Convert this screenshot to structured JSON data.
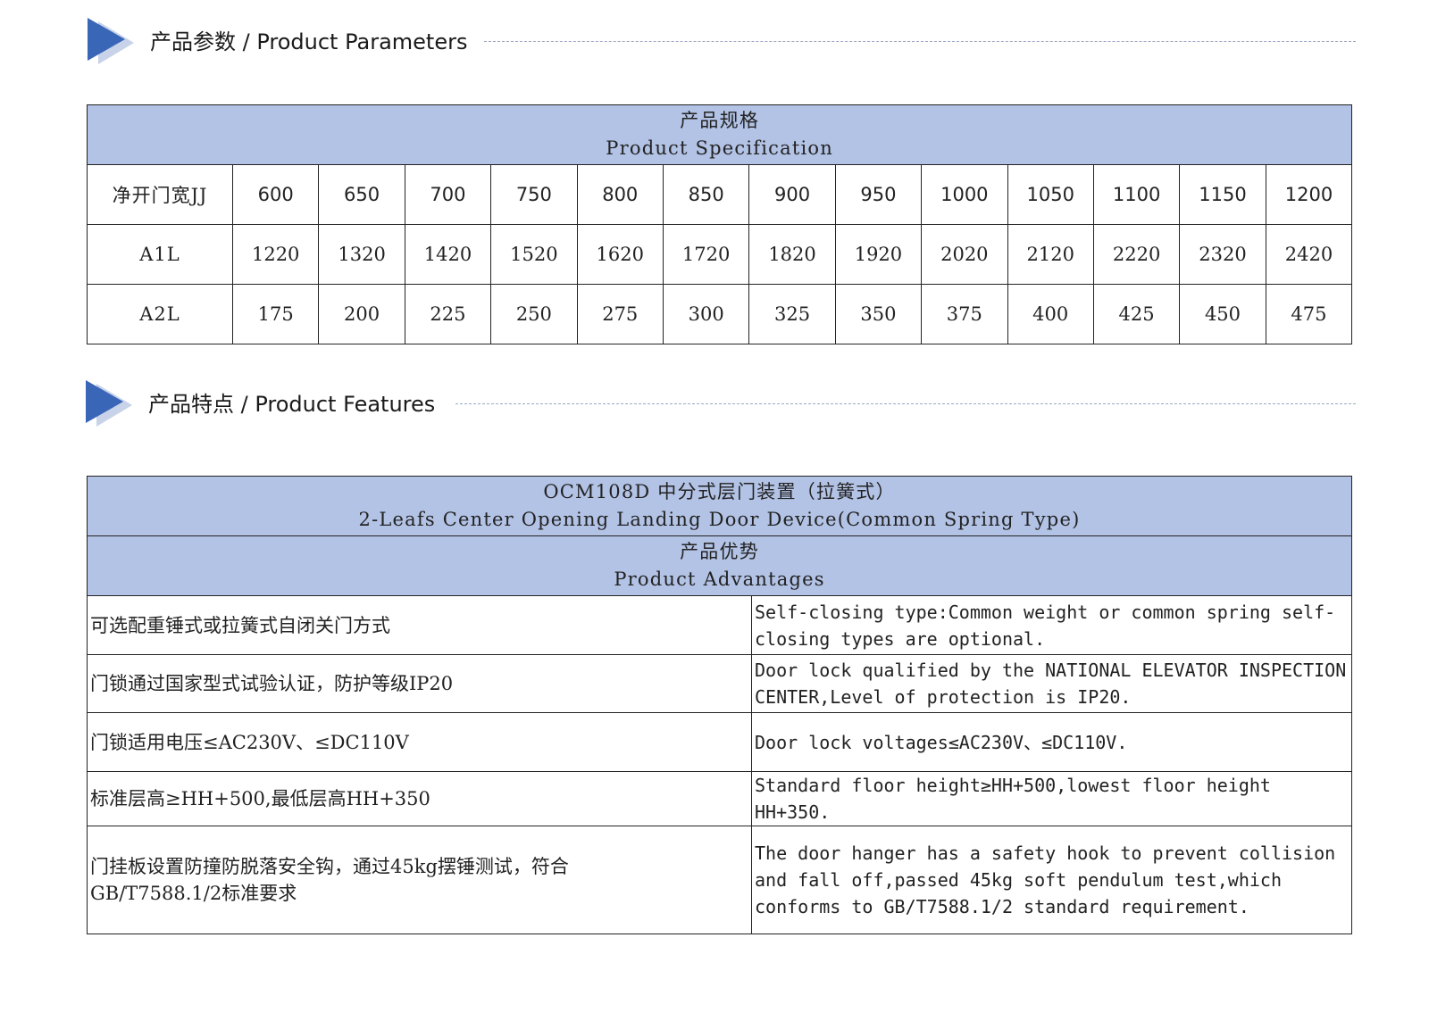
{
  "section1": {
    "title": "产品参数 / Product Parameters"
  },
  "spec_table": {
    "header_cn": "产品规格",
    "header_en": "Product Specification",
    "rows": [
      {
        "label": "净开门宽JJ",
        "values": [
          "600",
          "650",
          "700",
          "750",
          "800",
          "850",
          "900",
          "950",
          "1000",
          "1050",
          "1100",
          "1150",
          "1200"
        ]
      },
      {
        "label": "A1L",
        "values": [
          "1220",
          "1320",
          "1420",
          "1520",
          "1620",
          "1720",
          "1820",
          "1920",
          "2020",
          "2120",
          "2220",
          "2320",
          "2420"
        ]
      },
      {
        "label": "A2L",
        "values": [
          "175",
          "200",
          "225",
          "250",
          "275",
          "300",
          "325",
          "350",
          "375",
          "400",
          "425",
          "450",
          "475"
        ]
      }
    ]
  },
  "section2": {
    "title": "产品特点 / Product Features"
  },
  "feature_table": {
    "model_cn": "OCM108D 中分式层门装置（拉簧式）",
    "model_en": "2-Leafs Center Opening Landing Door Device(Common Spring Type)",
    "adv_cn": "产品优势",
    "adv_en": "Product Advantages",
    "rows": [
      {
        "cn": "可选配重锤式或拉簧式自闭关门方式",
        "en": "Self-closing type:Common weight or common spring self-closing types are optional."
      },
      {
        "cn": "门锁通过国家型式试验认证，防护等级IP20",
        "en": "Door lock qualified by the NATIONAL ELEVATOR INSPECTION CENTER,Level of protection is IP20."
      },
      {
        "cn": "门锁适用电压≤AC230V、≤DC110V",
        "en": "Door lock voltages≤AC230V、≤DC110V."
      },
      {
        "cn": "标准层高≥HH+500,最低层高HH+350",
        "en": "Standard floor height≥HH+500,lowest floor height HH+350."
      },
      {
        "cn": "门挂板设置防撞防脱落安全钩，通过45kg摆锤测试，符合GB/T7588.1/2标准要求",
        "en": "The door hanger has a safety hook to prevent collision and fall off,passed 45kg soft pendulum test,which conforms to GB/T7588.1/2 standard requirement."
      }
    ]
  },
  "colors": {
    "accent": "#3a66b8",
    "header_fill": "#b3c3e6"
  }
}
